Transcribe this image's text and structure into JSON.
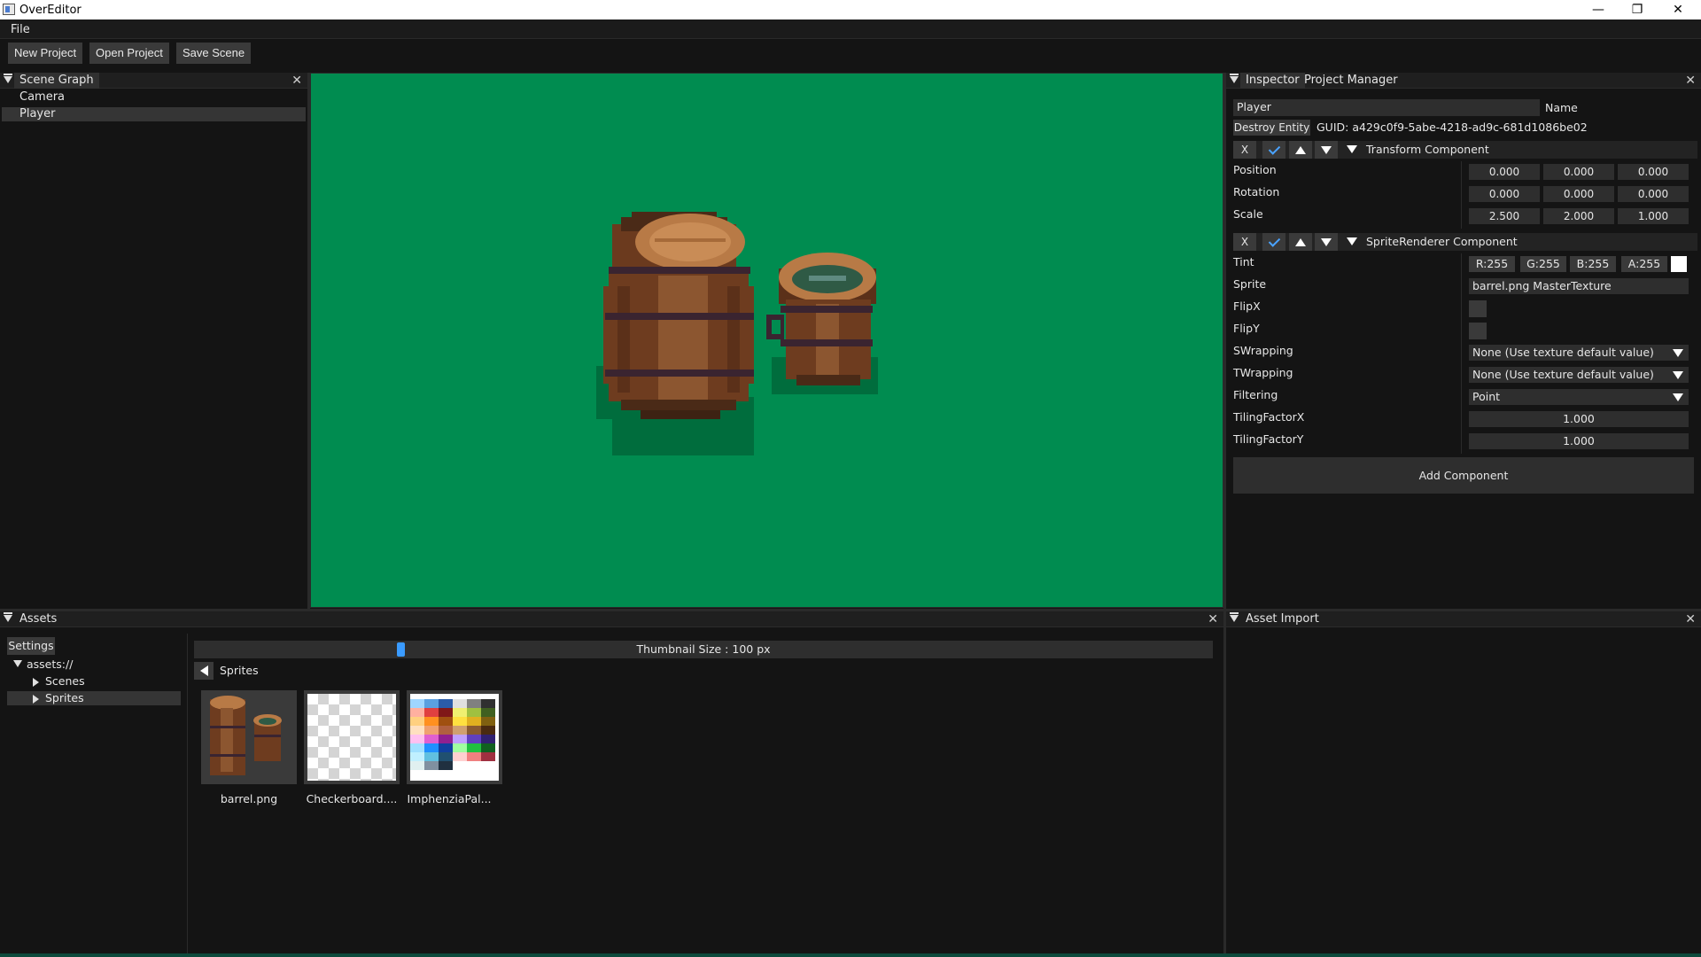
{
  "window": {
    "title": "OverEditor"
  },
  "menu": {
    "file": "File"
  },
  "toolbar": {
    "new_project": "New Project",
    "open_project": "Open Project",
    "save_scene": "Save Scene"
  },
  "scene_graph": {
    "tab": "Scene Graph",
    "items": [
      {
        "label": "Camera"
      },
      {
        "label": "Player"
      }
    ],
    "selected": "Player"
  },
  "inspector": {
    "tabs": [
      "Inspector",
      "Project Manager"
    ],
    "entity_name": "Player",
    "name_label": "Name",
    "destroy_button": "Destroy Entity",
    "guid": "GUID: a429c0f9-5abe-4218-ad9c-681d1086be02",
    "transform": {
      "title": "Transform Component",
      "remove_label": "X",
      "rows": [
        {
          "label": "Position",
          "values": [
            "0.000",
            "0.000",
            "0.000"
          ]
        },
        {
          "label": "Rotation",
          "values": [
            "0.000",
            "0.000",
            "0.000"
          ]
        },
        {
          "label": "Scale",
          "values": [
            "2.500",
            "2.000",
            "1.000"
          ]
        }
      ]
    },
    "sprite_renderer": {
      "title": "SpriteRenderer Component",
      "remove_label": "X",
      "tint_label": "Tint",
      "tint": {
        "r": "R:255",
        "g": "G:255",
        "b": "B:255",
        "a": "A:255",
        "swatch": "#ffffff"
      },
      "sprite_label": "Sprite",
      "sprite_value": "barrel.png MasterTexture",
      "flipx_label": "FlipX",
      "flipy_label": "FlipY",
      "swrapping_label": "SWrapping",
      "swrapping_value": "None (Use texture default value)",
      "twrapping_label": "TWrapping",
      "twrapping_value": "None (Use texture default value)",
      "filtering_label": "Filtering",
      "filtering_value": "Point",
      "tilingx_label": "TilingFactorX",
      "tilingx_value": "1.000",
      "tilingy_label": "TilingFactorY",
      "tilingy_value": "1.000"
    },
    "add_component": "Add Component"
  },
  "viewport": {
    "background": "#008c50"
  },
  "assets": {
    "tab": "Assets",
    "settings_button": "Settings",
    "root": "assets://",
    "folders": [
      {
        "label": "Scenes"
      },
      {
        "label": "Sprites"
      }
    ],
    "thumbnail_label": "Thumbnail Size : 100 px",
    "thumbnail_size": 100,
    "current_folder": "Sprites",
    "files": [
      {
        "label": "barrel.png",
        "icon": "barrel-thumbnail"
      },
      {
        "label": "Checkerboard....",
        "icon": "checkerboard-thumbnail"
      },
      {
        "label": "ImphenziaPal...",
        "icon": "palette-thumbnail"
      }
    ]
  },
  "asset_import": {
    "tab": "Asset Import"
  }
}
